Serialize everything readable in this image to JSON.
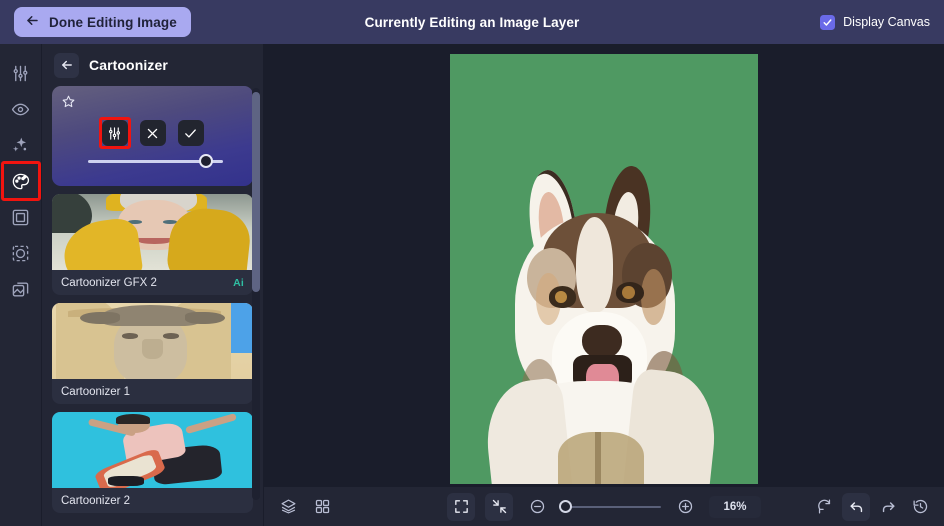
{
  "topbar": {
    "done_label": "Done Editing Image",
    "back_arrow_icon": "arrow-left-icon",
    "title": "Currently Editing an Image Layer",
    "display_canvas_label": "Display Canvas",
    "display_canvas_checked": true,
    "bg_color": "#383a61",
    "button_color": "#a9a9f0"
  },
  "rail": {
    "items": [
      {
        "icon": "adjustments-sliders-icon",
        "name": "adjust",
        "selected": false
      },
      {
        "icon": "eye-icon",
        "name": "visibility",
        "selected": false
      },
      {
        "icon": "sparkles-icon",
        "name": "effects-ai",
        "selected": false
      },
      {
        "icon": "palette-icon",
        "name": "artistic-palette",
        "selected": true
      },
      {
        "icon": "frame-icon",
        "name": "frame",
        "selected": false
      },
      {
        "icon": "mask-icon",
        "name": "mask",
        "selected": false
      },
      {
        "icon": "duplicate-layers-icon",
        "name": "duplicate",
        "selected": false
      }
    ],
    "highlight_color": "#f1140f"
  },
  "panel": {
    "back_icon": "arrow-left-icon",
    "title": "Cartoonizer",
    "active_card": {
      "star_icon": "star-outline-icon",
      "settings_icon": "adjustments-sliders-icon",
      "cancel_icon": "close-x-icon",
      "apply_icon": "check-icon",
      "settings_highlighted": true,
      "slider_value": 82
    },
    "effects": [
      {
        "name": "Cartoonizer GFX 2",
        "badge": "Ai",
        "art": "art-gfx2"
      },
      {
        "name": "Cartoonizer 1",
        "badge": "",
        "art": "art-c1"
      },
      {
        "name": "Cartoonizer 2",
        "badge": "",
        "art": "art-c2"
      }
    ],
    "badge_color": "#2fbfa3"
  },
  "canvas": {
    "background_color": "#4f9962",
    "subject": "cartoonized husky dog portrait"
  },
  "bottombar": {
    "left": [
      {
        "icon": "layers-icon",
        "name": "layers-panel-toggle"
      },
      {
        "icon": "grid-icon",
        "name": "grid-view-toggle"
      }
    ],
    "center": [
      {
        "icon": "expand-fullscreen-icon",
        "name": "fullscreen-toggle",
        "filled": true
      },
      {
        "icon": "fit-to-screen-icon",
        "name": "fit-to-screen",
        "filled": true
      },
      {
        "icon": "zoom-out-minus-icon",
        "name": "zoom-out"
      },
      {
        "icon": "zoom-in-plus-icon",
        "name": "zoom-in"
      }
    ],
    "zoom_value": "16%",
    "zoom_slider_position": 0,
    "right": [
      {
        "icon": "reset-rotate-icon",
        "name": "reset",
        "filled": false
      },
      {
        "icon": "undo-icon",
        "name": "undo",
        "filled": true
      },
      {
        "icon": "redo-icon",
        "name": "redo",
        "filled": false
      },
      {
        "icon": "history-clock-icon",
        "name": "history",
        "filled": false
      }
    ]
  }
}
